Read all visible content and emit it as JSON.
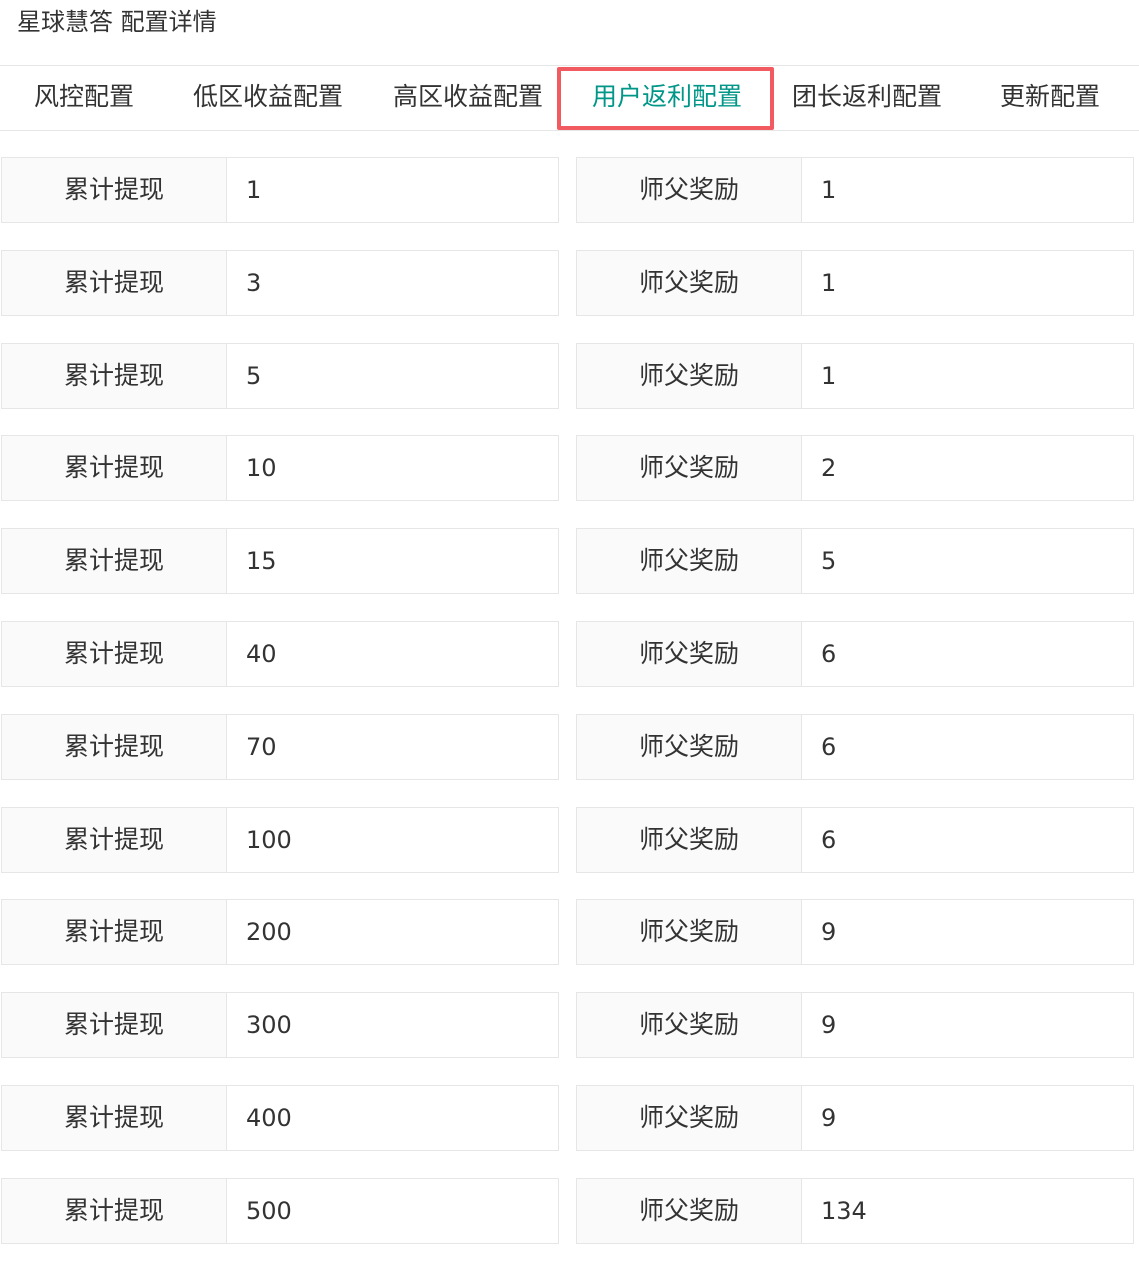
{
  "header": {
    "title": "星球慧答 配置详情"
  },
  "tabs": [
    {
      "label": "风控配置",
      "active": false
    },
    {
      "label": "低区收益配置",
      "active": false
    },
    {
      "label": "高区收益配置",
      "active": false
    },
    {
      "label": "用户返利配置",
      "active": true
    },
    {
      "label": "团长返利配置",
      "active": false
    },
    {
      "label": "更新配置",
      "active": false
    }
  ],
  "colors": {
    "active_tab": "#009688",
    "highlight_border": "#f05a60",
    "label_bg": "#fafafa",
    "border": "#e6e6e6"
  },
  "labels": {
    "withdraw": "累计提现",
    "reward": "师父奖励"
  },
  "rows": [
    {
      "withdraw_value": "1",
      "reward_value": "1"
    },
    {
      "withdraw_value": "3",
      "reward_value": "1"
    },
    {
      "withdraw_value": "5",
      "reward_value": "1"
    },
    {
      "withdraw_value": "10",
      "reward_value": "2"
    },
    {
      "withdraw_value": "15",
      "reward_value": "5"
    },
    {
      "withdraw_value": "40",
      "reward_value": "6"
    },
    {
      "withdraw_value": "70",
      "reward_value": "6"
    },
    {
      "withdraw_value": "100",
      "reward_value": "6"
    },
    {
      "withdraw_value": "200",
      "reward_value": "9"
    },
    {
      "withdraw_value": "300",
      "reward_value": "9"
    },
    {
      "withdraw_value": "400",
      "reward_value": "9"
    },
    {
      "withdraw_value": "500",
      "reward_value": "134"
    }
  ]
}
